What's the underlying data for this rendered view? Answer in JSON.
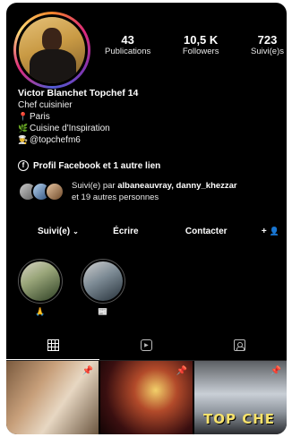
{
  "stats": {
    "publications": {
      "value": "43",
      "label": "Publications"
    },
    "followers": {
      "value": "10,5 K",
      "label": "Followers"
    },
    "following": {
      "value": "723",
      "label": "Suivi(e)s"
    }
  },
  "bio": {
    "name": "Victor Blanchet Topchef 14",
    "category": "Chef cuisinier",
    "location": "Paris",
    "tagline": "Cuisine d'Inspiration",
    "handle": "@topchefm6",
    "icons": {
      "location": "pin-icon",
      "tagline": "herb-icon",
      "handle": "chef-icon"
    }
  },
  "facebook": {
    "text": "Profil Facebook et 1 autre lien"
  },
  "followed_by": {
    "prefix": "Suivi(e) par ",
    "names": "albaneauvray, danny_khezzar",
    "suffix": "et 19 autres personnes"
  },
  "actions": {
    "follow": "Suivi(e)",
    "message": "Écrire",
    "contact": "Contacter",
    "add_person": "+"
  },
  "highlights": [
    {
      "emoji": "🙏"
    },
    {
      "emoji": "📰"
    }
  ],
  "tabs": [
    "grid-icon",
    "reels-icon",
    "tagged-icon"
  ],
  "posts": [
    {
      "pinned": true,
      "overlay_text": ""
    },
    {
      "pinned": true,
      "overlay_text": ""
    },
    {
      "pinned": true,
      "overlay_text": "TOP CHE"
    }
  ],
  "colors": {
    "background": "#000000",
    "text": "#ffffff",
    "ring_start": "#f58529",
    "ring_end": "#dd2a7b"
  }
}
